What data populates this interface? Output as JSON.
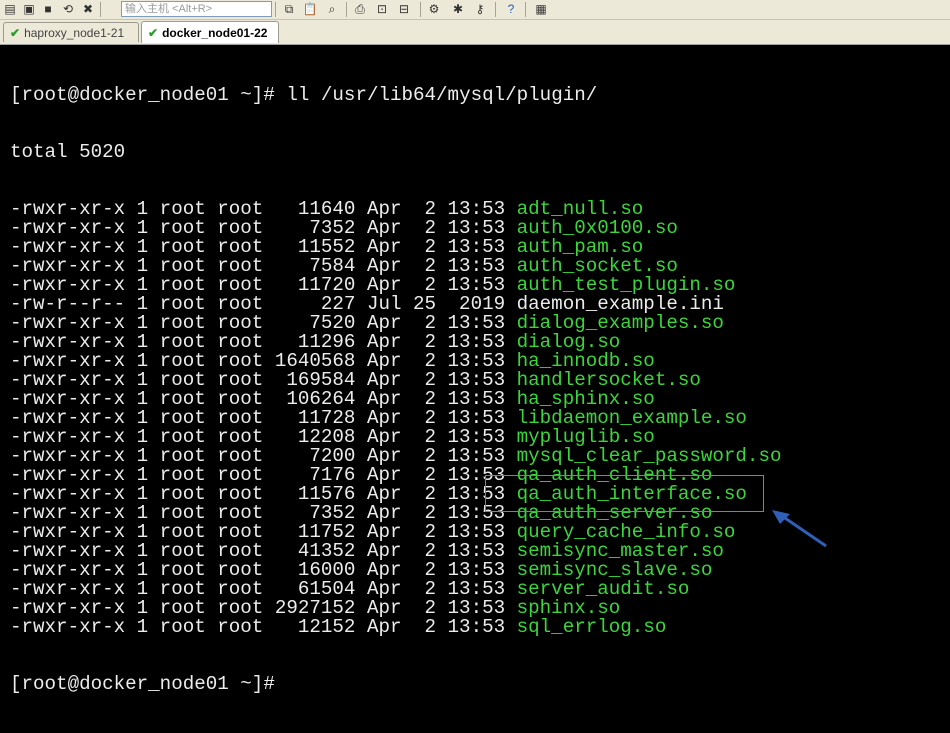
{
  "toolbar": {
    "host_placeholder": "输入主机 <Alt+R>",
    "icons": [
      "new-session-icon",
      "open-icon",
      "save-icon",
      "reconnect-icon",
      "disconnect-icon",
      "copy-icon",
      "paste-icon",
      "find-icon",
      "print-icon",
      "print-preview-icon",
      "settings-icon",
      "keymap-icon",
      "key-icon",
      "help-icon",
      "sftp-icon"
    ]
  },
  "tabs": [
    {
      "label": "haproxy_node1-21",
      "active": false
    },
    {
      "label": "docker_node01-22",
      "active": true
    }
  ],
  "terminal": {
    "prompt": "[root@docker_node01 ~]# ",
    "command": "ll /usr/lib64/mysql/plugin/",
    "total": "total 5020",
    "entries": [
      {
        "meta": "-rwxr-xr-x 1 root root   11640 Apr  2 13:53 ",
        "name": "adt_null.so",
        "exec": true
      },
      {
        "meta": "-rwxr-xr-x 1 root root    7352 Apr  2 13:53 ",
        "name": "auth_0x0100.so",
        "exec": true
      },
      {
        "meta": "-rwxr-xr-x 1 root root   11552 Apr  2 13:53 ",
        "name": "auth_pam.so",
        "exec": true
      },
      {
        "meta": "-rwxr-xr-x 1 root root    7584 Apr  2 13:53 ",
        "name": "auth_socket.so",
        "exec": true
      },
      {
        "meta": "-rwxr-xr-x 1 root root   11720 Apr  2 13:53 ",
        "name": "auth_test_plugin.so",
        "exec": true
      },
      {
        "meta": "-rw-r--r-- 1 root root     227 Jul 25  2019 ",
        "name": "daemon_example.ini",
        "exec": false
      },
      {
        "meta": "-rwxr-xr-x 1 root root    7520 Apr  2 13:53 ",
        "name": "dialog_examples.so",
        "exec": true
      },
      {
        "meta": "-rwxr-xr-x 1 root root   11296 Apr  2 13:53 ",
        "name": "dialog.so",
        "exec": true
      },
      {
        "meta": "-rwxr-xr-x 1 root root 1640568 Apr  2 13:53 ",
        "name": "ha_innodb.so",
        "exec": true
      },
      {
        "meta": "-rwxr-xr-x 1 root root  169584 Apr  2 13:53 ",
        "name": "handlersocket.so",
        "exec": true
      },
      {
        "meta": "-rwxr-xr-x 1 root root  106264 Apr  2 13:53 ",
        "name": "ha_sphinx.so",
        "exec": true
      },
      {
        "meta": "-rwxr-xr-x 1 root root   11728 Apr  2 13:53 ",
        "name": "libdaemon_example.so",
        "exec": true
      },
      {
        "meta": "-rwxr-xr-x 1 root root   12208 Apr  2 13:53 ",
        "name": "mypluglib.so",
        "exec": true
      },
      {
        "meta": "-rwxr-xr-x 1 root root    7200 Apr  2 13:53 ",
        "name": "mysql_clear_password.so",
        "exec": true
      },
      {
        "meta": "-rwxr-xr-x 1 root root    7176 Apr  2 13:53 ",
        "name": "qa_auth_client.so",
        "exec": true
      },
      {
        "meta": "-rwxr-xr-x 1 root root   11576 Apr  2 13:53 ",
        "name": "qa_auth_interface.so",
        "exec": true
      },
      {
        "meta": "-rwxr-xr-x 1 root root    7352 Apr  2 13:53 ",
        "name": "qa_auth_server.so",
        "exec": true
      },
      {
        "meta": "-rwxr-xr-x 1 root root   11752 Apr  2 13:53 ",
        "name": "query_cache_info.so",
        "exec": true
      },
      {
        "meta": "-rwxr-xr-x 1 root root   41352 Apr  2 13:53 ",
        "name": "semisync_master.so",
        "exec": true
      },
      {
        "meta": "-rwxr-xr-x 1 root root   16000 Apr  2 13:53 ",
        "name": "semisync_slave.so",
        "exec": true
      },
      {
        "meta": "-rwxr-xr-x 1 root root   61504 Apr  2 13:53 ",
        "name": "server_audit.so",
        "exec": true
      },
      {
        "meta": "-rwxr-xr-x 1 root root 2927152 Apr  2 13:53 ",
        "name": "sphinx.so",
        "exec": true
      },
      {
        "meta": "-rwxr-xr-x 1 root root   12152 Apr  2 13:53 ",
        "name": "sql_errlog.so",
        "exec": true
      }
    ],
    "final_prompt": "[root@docker_node01 ~]# "
  },
  "colors": {
    "terminal_bg": "#000000",
    "terminal_fg": "#ececec",
    "exec_file": "#3bd63b",
    "highlight_box": "#e0632e",
    "arrow": "#2f5fb8"
  }
}
